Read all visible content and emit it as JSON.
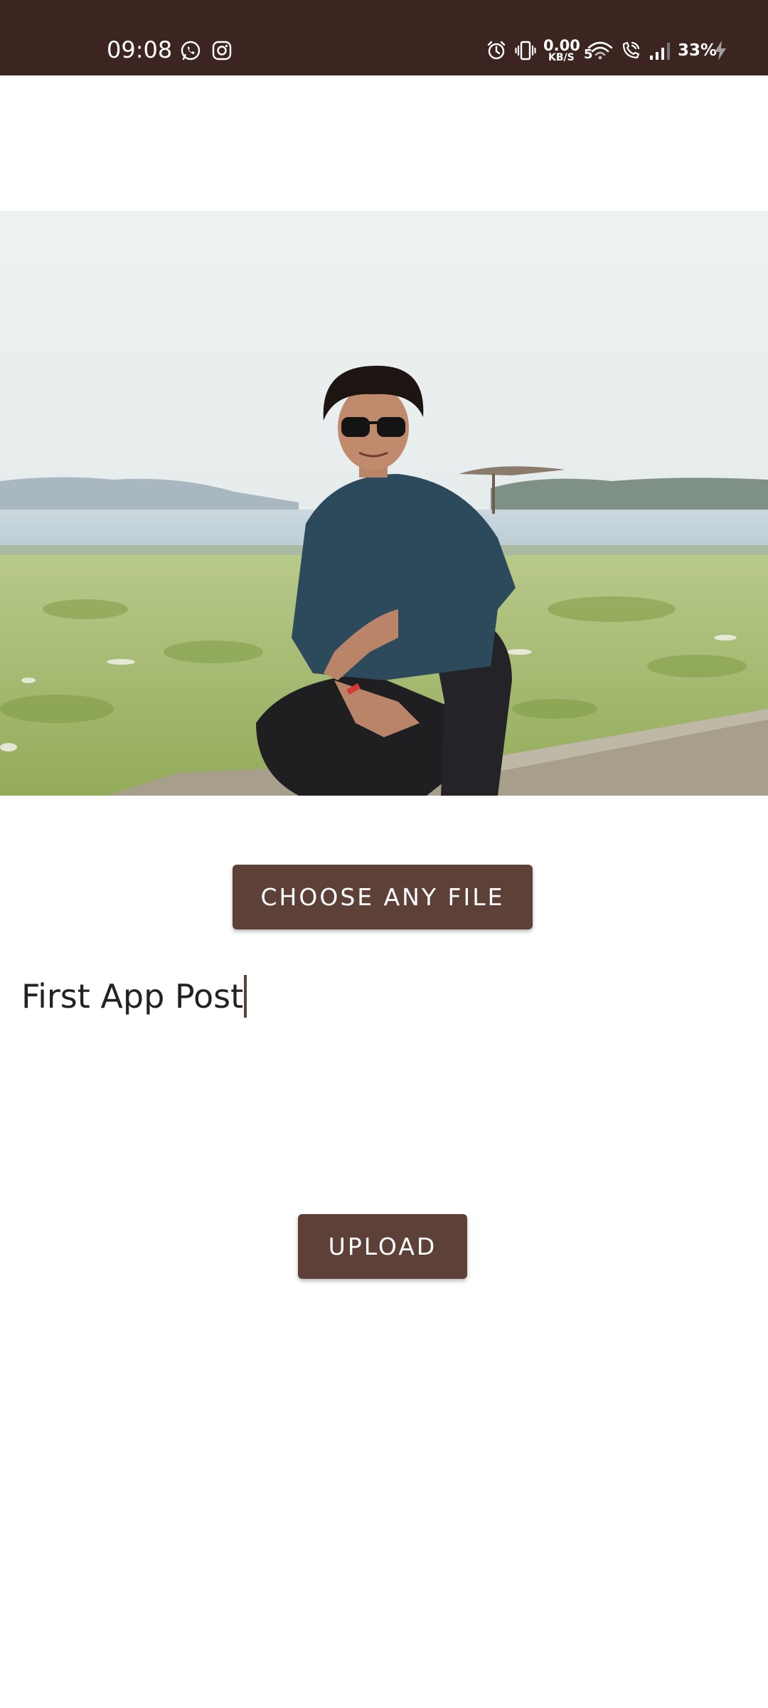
{
  "status_bar": {
    "time": "09:08",
    "network_speed_value": "0.00",
    "network_speed_unit": "KB/S",
    "wifi_label": "5",
    "battery_percent": "33%",
    "icons": [
      "whatsapp-icon",
      "instagram-icon",
      "alarm-icon",
      "vibrate-icon",
      "wifi-icon",
      "wifi-calling-icon",
      "signal-icon",
      "charging-icon"
    ],
    "background": "#3c2520"
  },
  "photo": {
    "subject": "image-preview"
  },
  "buttons": {
    "choose_label": "CHOOSE ANY FILE",
    "upload_label": "UPLOAD",
    "color": "#5d4037"
  },
  "caption": {
    "value": "First App Post"
  }
}
